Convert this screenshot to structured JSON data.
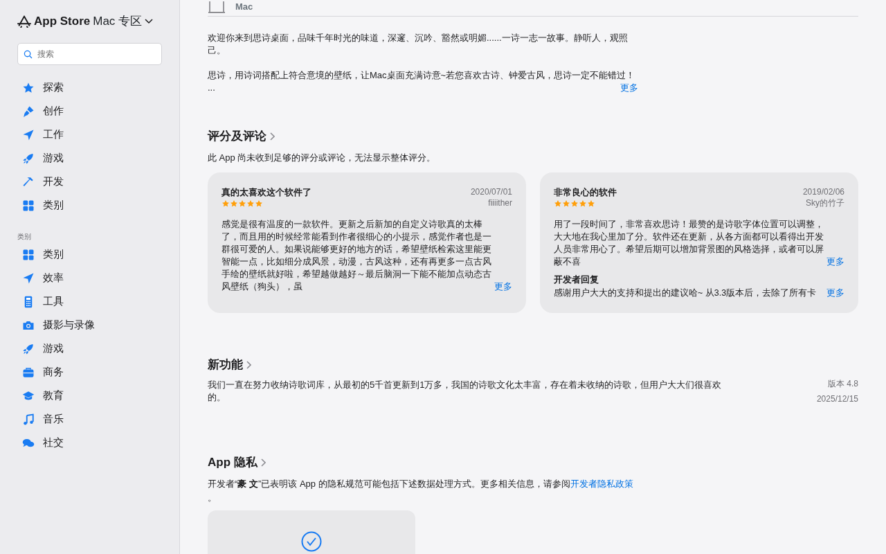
{
  "sidebar": {
    "brand": "App Store",
    "region": "Mac 专区",
    "search": {
      "placeholder": "搜索"
    },
    "items": [
      {
        "label": "探索",
        "kind": "star"
      },
      {
        "label": "创作",
        "kind": "brush"
      },
      {
        "label": "工作",
        "kind": "plane"
      },
      {
        "label": "游戏",
        "kind": "rocket"
      },
      {
        "label": "开发",
        "kind": "hammer"
      },
      {
        "label": "类别",
        "kind": "grid"
      }
    ],
    "section_title": "类别",
    "categories": [
      {
        "label": "类别",
        "kind": "grid"
      },
      {
        "label": "效率",
        "kind": "plane"
      },
      {
        "label": "工具",
        "kind": "calc"
      },
      {
        "label": "摄影与录像",
        "kind": "camera"
      },
      {
        "label": "游戏",
        "kind": "rocket"
      },
      {
        "label": "商务",
        "kind": "briefcase"
      },
      {
        "label": "教育",
        "kind": "cap"
      },
      {
        "label": "音乐",
        "kind": "music"
      },
      {
        "label": "社交",
        "kind": "chat"
      }
    ]
  },
  "device": {
    "label": "Mac"
  },
  "description": {
    "paragraphs": [
      "欢迎你来到思诗桌面，品味千年时光的味道，深邃、沉吟、豁然或明媚......一诗一志一故事。静听人，观照己。",
      "思诗，用诗词搭配上符合意境的壁纸，让Mac桌面充满诗意~若您喜欢古诗、钟爱古风，思诗一定不能错过！"
    ],
    "ellipsis": "...",
    "more": "更多"
  },
  "ratings": {
    "title": "评分及评论",
    "note": "此 App 尚未收到足够的评分或评论，无法显示整体评分。",
    "reviews": [
      {
        "title": "真的太喜欢这个软件了",
        "date": "2020/07/01",
        "author": "fiiiither",
        "stars": 5,
        "body": "感觉是很有温度的一款软件。更新之后新加的自定义诗歌真的太棒了，而且用的时候经常能看到作者很细心的小提示，感觉作者也是一群很可爱的人。如果说能够更好的地方的话，希望壁纸检索这里能更智能一点，比如细分成风景，动漫，古风这种，还有再更多一点古风手绘的壁纸就好啦，希望越做越好～最后脑洞一下能不能加点动态古风壁纸（狗头），虽",
        "more": "更多"
      },
      {
        "title": "非常良心的软件",
        "date": "2019/02/06",
        "author": "Sky的竹子",
        "stars": 5,
        "body": "用了一段时间了，非常喜欢思诗！最赞的是诗歌字体位置可以调整，大大地在我心里加了分。软件还在更新，从各方面都可以看得出开发人员非常用心了。希望后期可以增加背景图的风格选择，或者可以屏蔽不喜",
        "more": "更多",
        "reply": {
          "title": "开发者回复",
          "body": "感谢用户大大的支持和提出的建议哈~ 从3.3版本后，去除了所有卡",
          "more": "更多"
        }
      }
    ]
  },
  "whats_new": {
    "title": "新功能",
    "text": "我们一直在努力收纳诗歌词库，从最初的5千首更新到1万多，我国的诗歌文化太丰富，存在着未收纳的诗歌，但用户大大们很喜欢的。",
    "version": "版本 4.8",
    "date": "2025/12/15"
  },
  "privacy": {
    "title": "App 隐私",
    "text": "开发者“**豪 文**”已表明该 App 的隐私规范可能包括下述数据处理方式。更多相关信息，请参阅",
    "link": "开发者隐私政策",
    "tail": "。"
  }
}
